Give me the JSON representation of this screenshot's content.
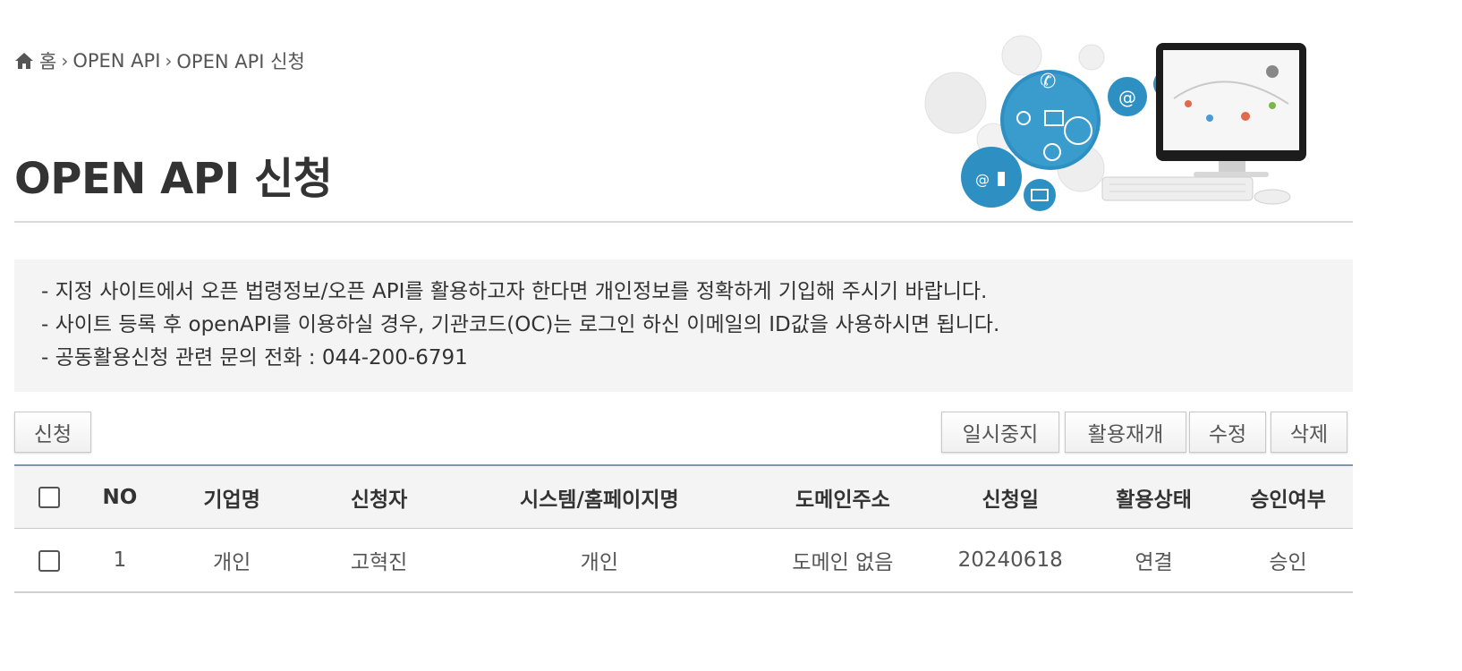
{
  "breadcrumb": {
    "home": "홈",
    "level1": "OPEN API",
    "level2": "OPEN API 신청"
  },
  "page": {
    "title": "OPEN API 신청"
  },
  "notice": {
    "lines": [
      "- 지정 사이트에서 오픈 법령정보/오픈 API를 활용하고자 한다면 개인정보를 정확하게 기입해 주시기 바랍니다.",
      "- 사이트 등록 후 openAPI를 이용하실 경우, 기관코드(OC)는 로그인 하신 이메일의 ID값을 사용하시면 됩니다.",
      "- 공동활용신청 관련 문의 전화 : 044-200-6791"
    ]
  },
  "toolbar": {
    "apply": "신청",
    "suspend": "일시중지",
    "resume": "활용재개",
    "edit": "수정",
    "delete": "삭제"
  },
  "table": {
    "columns": [
      "NO",
      "기업명",
      "신청자",
      "시스템/홈페이지명",
      "도메인주소",
      "신청일",
      "활용상태",
      "승인여부"
    ],
    "rows": [
      [
        "1",
        "개인",
        "고혁진",
        "개인",
        "도메인 없음",
        "20240618",
        "연결",
        "승인"
      ]
    ]
  },
  "colors": {
    "accent_line": "#7f96b3",
    "illustration_blue": "#2e8fc2",
    "panel_bg": "#f4f4f4"
  },
  "icons": {
    "home": "home-icon",
    "separator": "chevron-right-icon",
    "illustration": "computer-network-illustration"
  }
}
